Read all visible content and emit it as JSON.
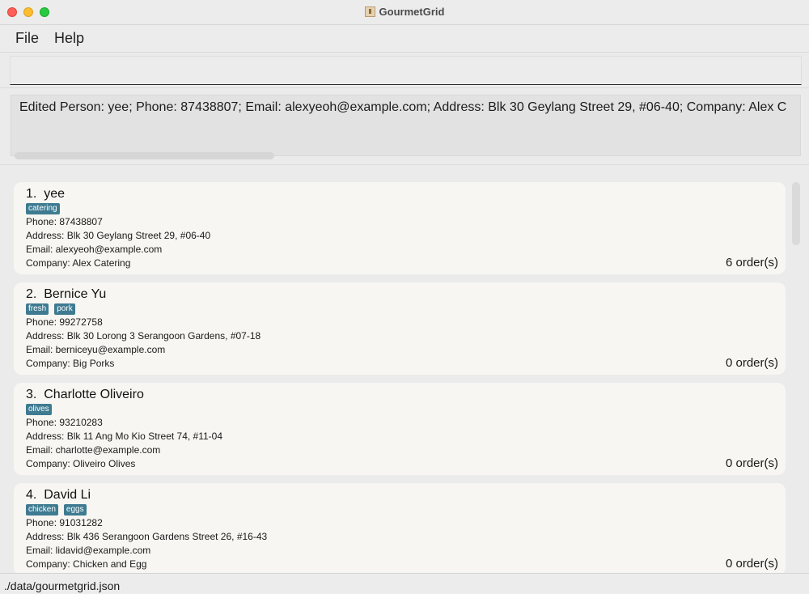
{
  "window": {
    "title": "GourmetGrid"
  },
  "menu": {
    "file": "File",
    "help": "Help"
  },
  "command": {
    "value": "",
    "placeholder": ""
  },
  "result": {
    "text": "Edited Person: yee; Phone: 87438807; Email: alexyeoh@example.com; Address: Blk 30 Geylang Street 29, #06-40; Company: Alex C"
  },
  "persons": [
    {
      "index": "1.",
      "name": "yee",
      "tags": [
        "catering"
      ],
      "phone": "Phone: 87438807",
      "address": "Address: Blk 30 Geylang Street 29, #06-40",
      "email": "Email: alexyeoh@example.com",
      "company": "Company: Alex Catering",
      "orders": "6 order(s)"
    },
    {
      "index": "2.",
      "name": "Bernice Yu",
      "tags": [
        "fresh",
        "pork"
      ],
      "phone": "Phone: 99272758",
      "address": "Address: Blk 30 Lorong 3 Serangoon Gardens, #07-18",
      "email": "Email: berniceyu@example.com",
      "company": "Company: Big Porks",
      "orders": "0 order(s)"
    },
    {
      "index": "3.",
      "name": "Charlotte Oliveiro",
      "tags": [
        "olives"
      ],
      "phone": "Phone: 93210283",
      "address": "Address: Blk 11 Ang Mo Kio Street 74, #11-04",
      "email": "Email: charlotte@example.com",
      "company": "Company: Oliveiro Olives",
      "orders": "0 order(s)"
    },
    {
      "index": "4.",
      "name": "David Li",
      "tags": [
        "chicken",
        "eggs"
      ],
      "phone": "Phone: 91031282",
      "address": "Address: Blk 436 Serangoon Gardens Street 26, #16-43",
      "email": "Email: lidavid@example.com",
      "company": "Company: Chicken and Egg",
      "orders": "0 order(s)"
    }
  ],
  "status": {
    "path": "./data/gourmetgrid.json"
  },
  "colors": {
    "tag": "#3e7b91",
    "card": "#f7f6f2",
    "background": "#ebebeb"
  }
}
